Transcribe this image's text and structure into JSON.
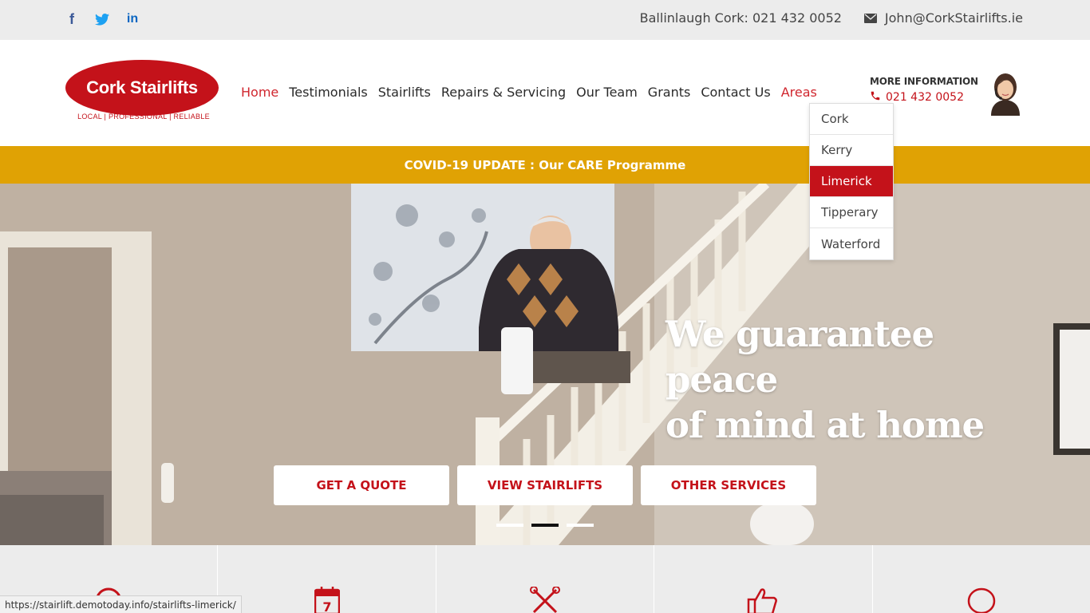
{
  "topbar": {
    "social": [
      {
        "name": "facebook-icon",
        "glyph": "f"
      },
      {
        "name": "twitter-icon",
        "glyph": "🐦"
      },
      {
        "name": "linkedin-icon",
        "glyph": "in"
      }
    ],
    "phone_text": "Ballinlaugh Cork: 021 432 0052",
    "email_text": "John@CorkStairlifts.ie"
  },
  "logo": {
    "title": "Cork Stairlifts",
    "tagline": "LOCAL | PROFESSIONAL | RELIABLE"
  },
  "nav": {
    "items": [
      "Home",
      "Testimonials",
      "Stairlifts",
      "Repairs & Servicing",
      "Our Team",
      "Grants",
      "Contact Us",
      "Areas"
    ]
  },
  "more_info": {
    "title": "MORE INFORMATION",
    "phone": "021 432 0052"
  },
  "areas_dropdown": {
    "items": [
      "Cork",
      "Kerry",
      "Limerick",
      "Tipperary",
      "Waterford"
    ],
    "hovered": "Limerick"
  },
  "covid_bar": {
    "text": "COVID-19 UPDATE : Our CARE Programme"
  },
  "hero": {
    "headline_line1": "We guarantee peace",
    "headline_line2": "of mind at home",
    "buttons": [
      "GET A QUOTE",
      "VIEW STAIRLIFTS",
      "OTHER SERVICES"
    ],
    "slides": 3,
    "active_slide": 2
  },
  "features": {
    "icons": [
      "pin-icon",
      "calendar-icon",
      "tools-icon",
      "thumbs-up-icon",
      "speech-icon"
    ],
    "calendar_day": "7"
  },
  "status_url": "https://stairlift.demotoday.info/stairlifts-limerick/",
  "colors": {
    "brand_red": "#c4121a",
    "covid_yellow": "#e0a204",
    "topbar_grey": "#ececec"
  }
}
